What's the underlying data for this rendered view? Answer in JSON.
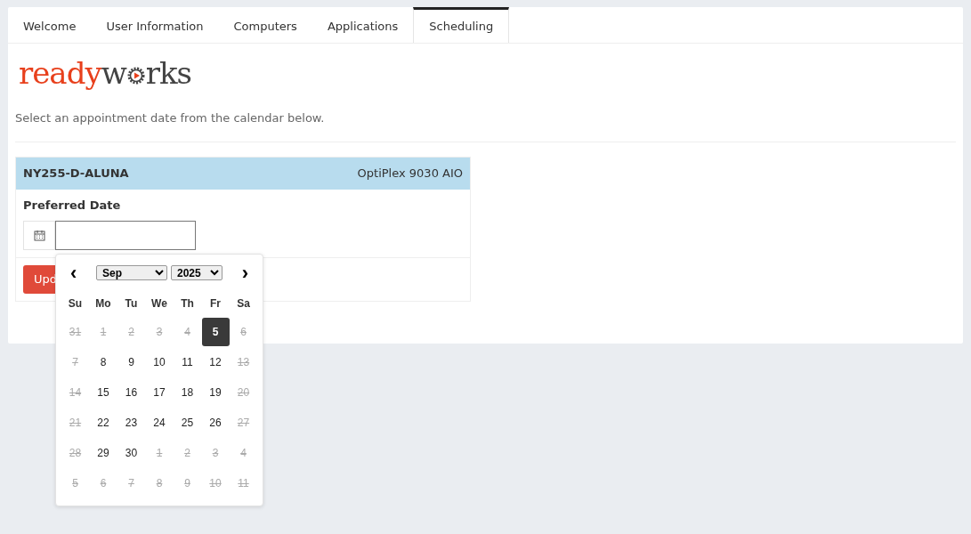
{
  "tabs": [
    {
      "label": "Welcome",
      "selected": false
    },
    {
      "label": "User Information",
      "selected": false
    },
    {
      "label": "Computers",
      "selected": false
    },
    {
      "label": "Applications",
      "selected": false
    },
    {
      "label": "Scheduling",
      "selected": true
    }
  ],
  "logo": {
    "part_1": "ready",
    "part_2": "w",
    "part_3": "rks"
  },
  "instructions": "Select an appointment date from the calendar below.",
  "device": {
    "name": "NY255-D-ALUNA",
    "model": "OptiPlex 9030 AIO"
  },
  "date_field": {
    "label": "Preferred Date"
  },
  "update_button": "Upd",
  "calendar": {
    "prev": "‹",
    "next": "›",
    "month": "Sep",
    "year": "2025",
    "weekdays": [
      "Su",
      "Mo",
      "Tu",
      "We",
      "Th",
      "Fr",
      "Sa"
    ],
    "weeks": [
      [
        {
          "day": "31",
          "disabled": true,
          "selected": false
        },
        {
          "day": "1",
          "disabled": true,
          "selected": false
        },
        {
          "day": "2",
          "disabled": true,
          "selected": false
        },
        {
          "day": "3",
          "disabled": true,
          "selected": false
        },
        {
          "day": "4",
          "disabled": true,
          "selected": false
        },
        {
          "day": "5",
          "disabled": false,
          "selected": true
        },
        {
          "day": "6",
          "disabled": true,
          "selected": false
        }
      ],
      [
        {
          "day": "7",
          "disabled": true,
          "selected": false
        },
        {
          "day": "8",
          "disabled": false,
          "selected": false
        },
        {
          "day": "9",
          "disabled": false,
          "selected": false
        },
        {
          "day": "10",
          "disabled": false,
          "selected": false
        },
        {
          "day": "11",
          "disabled": false,
          "selected": false
        },
        {
          "day": "12",
          "disabled": false,
          "selected": false
        },
        {
          "day": "13",
          "disabled": true,
          "selected": false
        }
      ],
      [
        {
          "day": "14",
          "disabled": true,
          "selected": false
        },
        {
          "day": "15",
          "disabled": false,
          "selected": false
        },
        {
          "day": "16",
          "disabled": false,
          "selected": false
        },
        {
          "day": "17",
          "disabled": false,
          "selected": false
        },
        {
          "day": "18",
          "disabled": false,
          "selected": false
        },
        {
          "day": "19",
          "disabled": false,
          "selected": false
        },
        {
          "day": "20",
          "disabled": true,
          "selected": false
        }
      ],
      [
        {
          "day": "21",
          "disabled": true,
          "selected": false
        },
        {
          "day": "22",
          "disabled": false,
          "selected": false
        },
        {
          "day": "23",
          "disabled": false,
          "selected": false
        },
        {
          "day": "24",
          "disabled": false,
          "selected": false
        },
        {
          "day": "25",
          "disabled": false,
          "selected": false
        },
        {
          "day": "26",
          "disabled": false,
          "selected": false
        },
        {
          "day": "27",
          "disabled": true,
          "selected": false
        }
      ],
      [
        {
          "day": "28",
          "disabled": true,
          "selected": false
        },
        {
          "day": "29",
          "disabled": false,
          "selected": false
        },
        {
          "day": "30",
          "disabled": false,
          "selected": false
        },
        {
          "day": "1",
          "disabled": true,
          "selected": false
        },
        {
          "day": "2",
          "disabled": true,
          "selected": false
        },
        {
          "day": "3",
          "disabled": true,
          "selected": false
        },
        {
          "day": "4",
          "disabled": true,
          "selected": false
        }
      ],
      [
        {
          "day": "5",
          "disabled": true,
          "selected": false
        },
        {
          "day": "6",
          "disabled": true,
          "selected": false
        },
        {
          "day": "7",
          "disabled": true,
          "selected": false
        },
        {
          "day": "8",
          "disabled": true,
          "selected": false
        },
        {
          "day": "9",
          "disabled": true,
          "selected": false
        },
        {
          "day": "10",
          "disabled": true,
          "selected": false
        },
        {
          "day": "11",
          "disabled": true,
          "selected": false
        }
      ]
    ]
  }
}
